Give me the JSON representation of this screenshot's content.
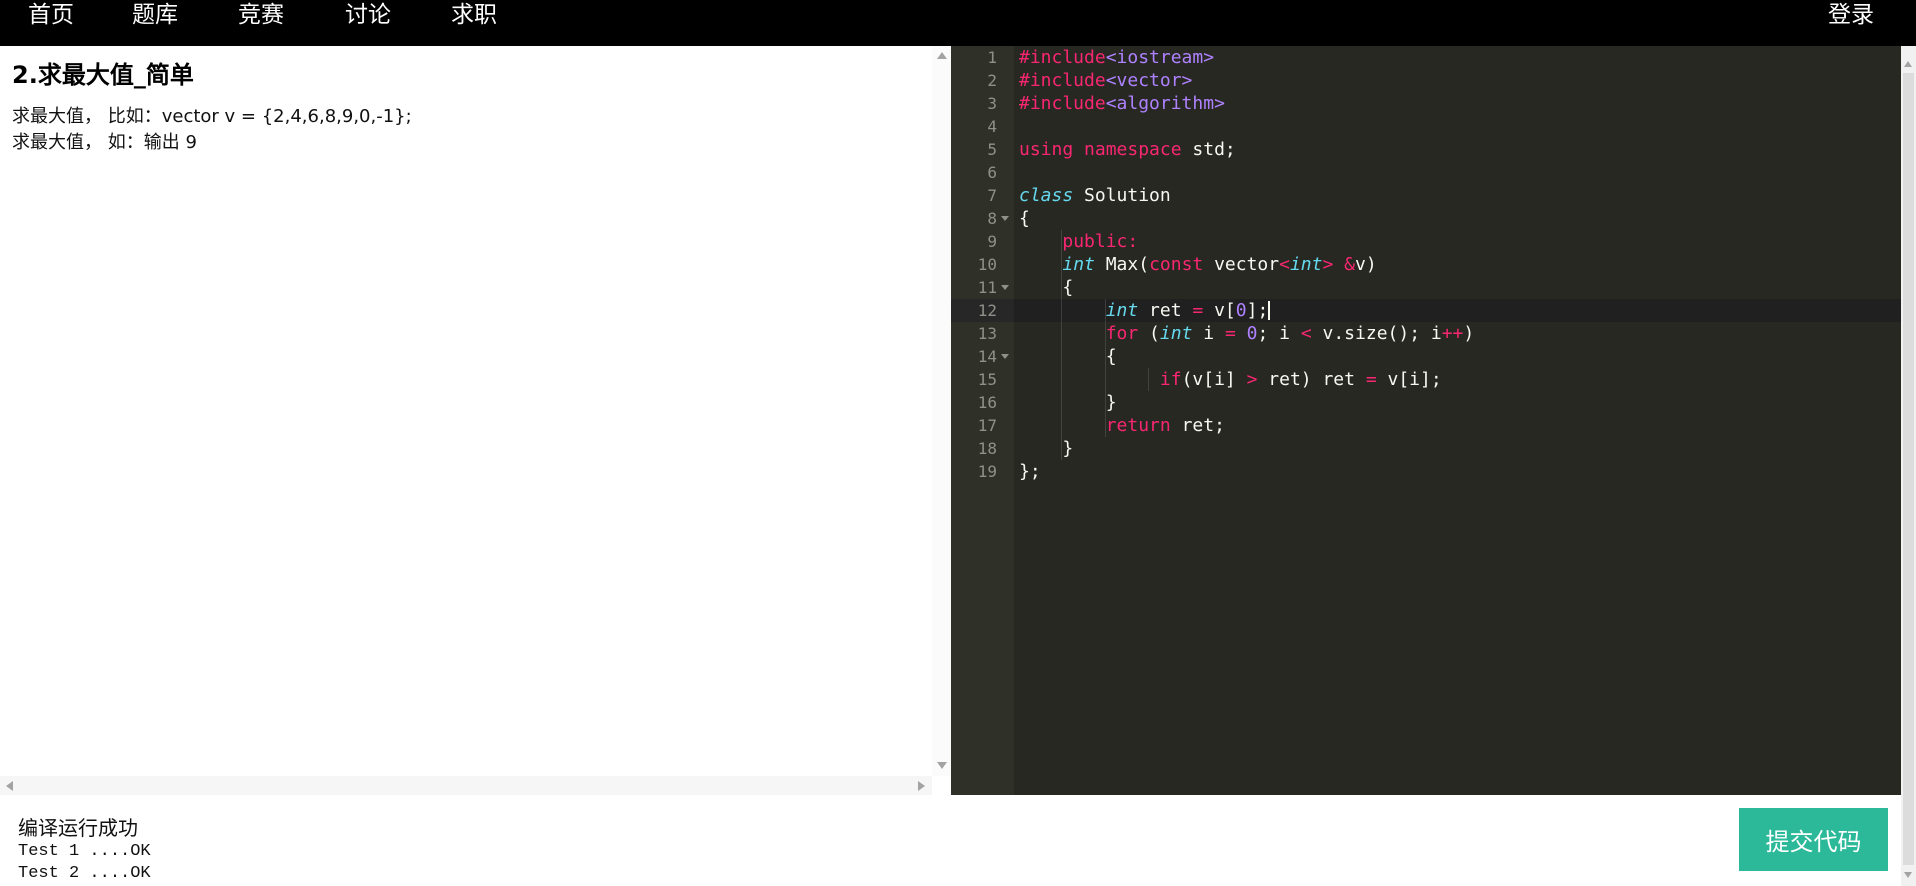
{
  "nav": {
    "items": [
      "首页",
      "题库",
      "竞赛",
      "讨论",
      "求职"
    ],
    "login": "登录"
  },
  "problem": {
    "title": "2.求最大值_简单",
    "description": [
      "求最大值， 比如：vector v = {2,4,6,8,9,0,-1};",
      "求最大值， 如：输出 9"
    ]
  },
  "editor": {
    "colors": {
      "background": "#272822",
      "gutter": "#2f3129",
      "gutter_text": "#8f908a",
      "text": "#f8f8f2",
      "active_line": "#202020",
      "gutter_active": "#272727",
      "cursor": "#f8f8f0"
    },
    "active_line": 12,
    "fold_lines": [
      8,
      11,
      14
    ],
    "lines": [
      {
        "n": 1,
        "tokens": [
          [
            "#include",
            "#f92672"
          ],
          [
            "<iostream>",
            "#ae81ff"
          ]
        ]
      },
      {
        "n": 2,
        "tokens": [
          [
            "#include",
            "#f92672"
          ],
          [
            "<vector>",
            "#ae81ff"
          ]
        ]
      },
      {
        "n": 3,
        "tokens": [
          [
            "#include",
            "#f92672"
          ],
          [
            "<algorithm>",
            "#ae81ff"
          ]
        ]
      },
      {
        "n": 4,
        "tokens": []
      },
      {
        "n": 5,
        "tokens": [
          [
            "using",
            "#f92672"
          ],
          [
            " "
          ],
          [
            "namespace",
            "#f92672"
          ],
          [
            " std;"
          ]
        ]
      },
      {
        "n": 6,
        "tokens": []
      },
      {
        "n": 7,
        "tokens": [
          [
            "class",
            "#66d9ef",
            1
          ],
          [
            " Solution"
          ]
        ]
      },
      {
        "n": 8,
        "tokens": [
          [
            "{"
          ]
        ]
      },
      {
        "n": 9,
        "tokens": [
          [
            "    "
          ],
          [
            "public:",
            "#f92672"
          ]
        ]
      },
      {
        "n": 10,
        "tokens": [
          [
            "    "
          ],
          [
            "int",
            "#66d9ef",
            1
          ],
          [
            " Max("
          ],
          [
            "const",
            "#f92672"
          ],
          [
            " vector"
          ],
          [
            "<",
            "#f92672"
          ],
          [
            "int",
            "#66d9ef",
            1
          ],
          [
            ">",
            "#f92672"
          ],
          [
            " "
          ],
          [
            "&",
            "#f92672"
          ],
          [
            "v)"
          ]
        ]
      },
      {
        "n": 11,
        "tokens": [
          [
            "    {"
          ]
        ]
      },
      {
        "n": 12,
        "tokens": [
          [
            "        "
          ],
          [
            "int",
            "#66d9ef",
            1
          ],
          [
            " ret "
          ],
          [
            "=",
            "#f92672"
          ],
          [
            " v["
          ],
          [
            "0",
            "#ae81ff"
          ],
          [
            "];"
          ]
        ]
      },
      {
        "n": 13,
        "tokens": [
          [
            "        "
          ],
          [
            "for",
            "#f92672"
          ],
          [
            " ("
          ],
          [
            "int",
            "#66d9ef",
            1
          ],
          [
            " i "
          ],
          [
            "=",
            "#f92672"
          ],
          [
            " "
          ],
          [
            "0",
            "#ae81ff"
          ],
          [
            "; i "
          ],
          [
            "<",
            "#f92672"
          ],
          [
            " v.size(); i"
          ],
          [
            "++",
            "#f92672"
          ],
          [
            ")"
          ]
        ]
      },
      {
        "n": 14,
        "tokens": [
          [
            "        {"
          ]
        ]
      },
      {
        "n": 15,
        "tokens": [
          [
            "             "
          ],
          [
            "if",
            "#f92672"
          ],
          [
            "(v[i] "
          ],
          [
            ">",
            "#f92672"
          ],
          [
            " ret) ret "
          ],
          [
            "=",
            "#f92672"
          ],
          [
            " v[i];"
          ]
        ]
      },
      {
        "n": 16,
        "tokens": [
          [
            "        }"
          ]
        ]
      },
      {
        "n": 17,
        "tokens": [
          [
            "        "
          ],
          [
            "return",
            "#f92672"
          ],
          [
            " ret;"
          ]
        ]
      },
      {
        "n": 18,
        "tokens": [
          [
            "    }"
          ]
        ]
      },
      {
        "n": 19,
        "tokens": [
          [
            "};"
          ]
        ]
      }
    ]
  },
  "result": {
    "status": "编译运行成功",
    "tests": [
      "Test 1 ....OK",
      "Test 2 ....OK"
    ]
  },
  "submit_label": "提交代码",
  "colors": {
    "nav_bg": "#000000",
    "accent": "#2bb99a"
  }
}
